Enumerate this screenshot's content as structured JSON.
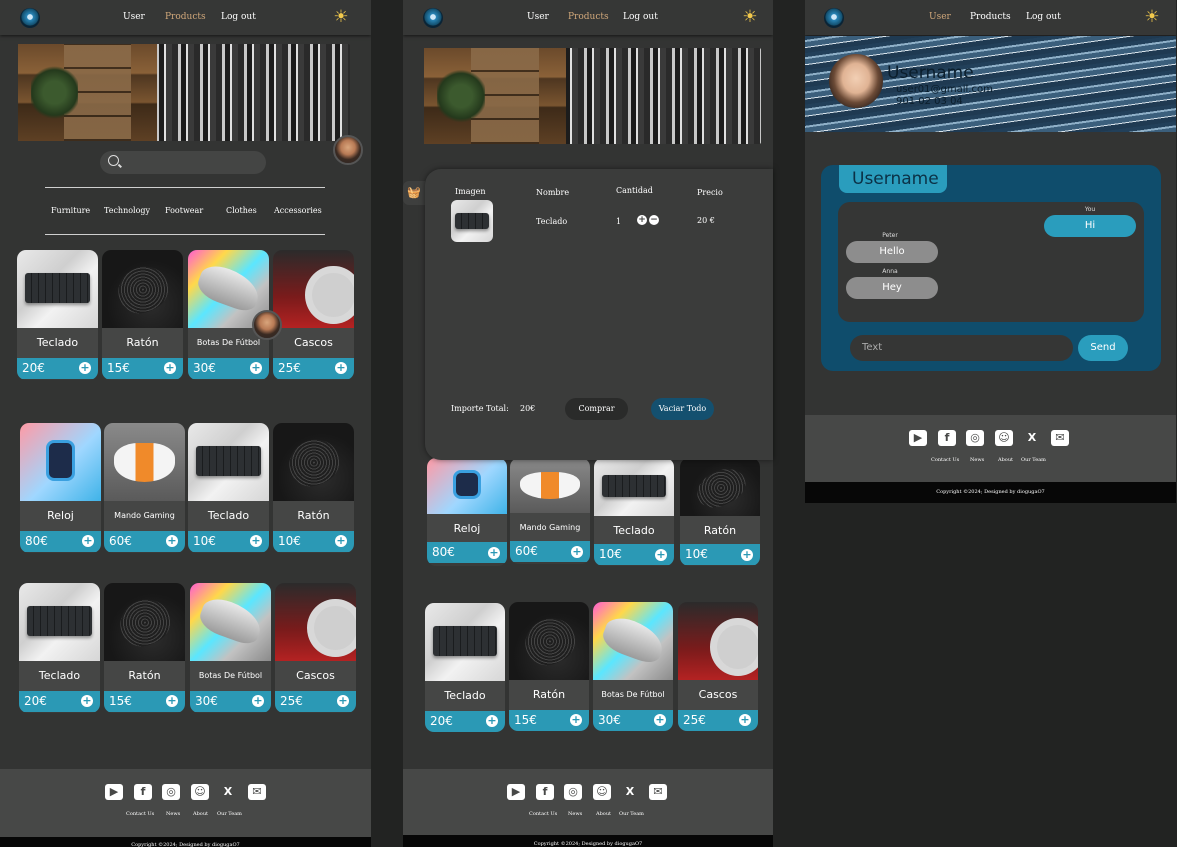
{
  "nav": {
    "user": "User",
    "products": "Products",
    "logout": "Log out"
  },
  "categories": [
    "Furniture",
    "Technology",
    "Footwear",
    "Clothes",
    "Accessories"
  ],
  "grid1": [
    {
      "name": "Teclado",
      "price": "20€"
    },
    {
      "name": "Ratón",
      "price": "15€"
    },
    {
      "name": "Botas De Fútbol",
      "price": "30€"
    },
    {
      "name": "Cascos",
      "price": "25€"
    },
    {
      "name": "Reloj",
      "price": "80€"
    },
    {
      "name": "Mando Gaming",
      "price": "60€"
    },
    {
      "name": "Teclado",
      "price": "10€"
    },
    {
      "name": "Ratón",
      "price": "10€"
    },
    {
      "name": "Teclado",
      "price": "20€"
    },
    {
      "name": "Ratón",
      "price": "15€"
    },
    {
      "name": "Botas De Fútbol",
      "price": "30€"
    },
    {
      "name": "Cascos",
      "price": "25€"
    }
  ],
  "grid2": [
    {
      "name": "Reloj",
      "price": "80€"
    },
    {
      "name": "Mando Gaming",
      "price": "60€"
    },
    {
      "name": "Teclado",
      "price": "10€"
    },
    {
      "name": "Ratón",
      "price": "10€"
    },
    {
      "name": "Teclado",
      "price": "20€"
    },
    {
      "name": "Ratón",
      "price": "15€"
    },
    {
      "name": "Botas De Fútbol",
      "price": "30€"
    },
    {
      "name": "Cascos",
      "price": "25€"
    }
  ],
  "cart": {
    "col_image": "Imagen",
    "col_name": "Nombre",
    "col_qty": "Cantidad",
    "col_price": "Precio",
    "item": {
      "name": "Teclado",
      "qty": "1",
      "price": "20 €"
    },
    "total_label": "Importe Total:",
    "total_value": "20€",
    "buy": "Comprar",
    "clear": "Vaciar Todo"
  },
  "profile": {
    "username": "Username",
    "email": "user01@gmail.com",
    "phone": "901 02 03 04"
  },
  "chat": {
    "title": "Username",
    "messages": [
      {
        "who": "You",
        "text": "Hi"
      },
      {
        "who": "Peter",
        "text": "Hello"
      },
      {
        "who": "Anna",
        "text": "Hey"
      }
    ],
    "placeholder": "Text",
    "send": "Send"
  },
  "footer": {
    "links": [
      "Contact Us",
      "News",
      "About",
      "Our Team"
    ],
    "copyright": "Copyright ©2024; Designed by diogugaO7"
  },
  "icons": {
    "social": [
      "youtube-icon",
      "facebook-icon",
      "instagram-icon",
      "discord-icon",
      "x-icon",
      "mail-icon"
    ]
  },
  "colors": {
    "accent": "#2b99b5",
    "nav_active": "#d0a77a",
    "chat_bg": "#0f4d6c"
  }
}
